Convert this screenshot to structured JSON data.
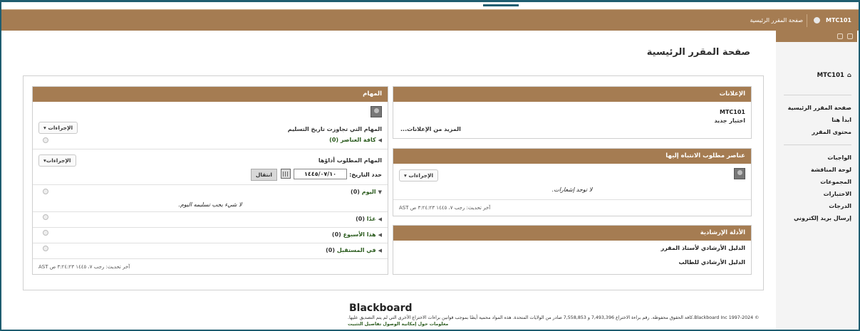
{
  "topbar": {
    "course_code": "MTC101",
    "home_link": "صفحة المقرر الرئيسية"
  },
  "sidebar": {
    "course_title": "MTC101",
    "home_icon": "house-icon",
    "group1": [
      "صفحة المقرر الرئيسية",
      "ابدأ هنا",
      "محتوى المقرر"
    ],
    "group2": [
      "الواجبات",
      "لوحة المناقشة",
      "المجموعات",
      "الاختبارات",
      "الدرجات",
      "إرسال بريد إلكتروني"
    ]
  },
  "main": {
    "title": "صفحة المقرر الرئيسية"
  },
  "announcements": {
    "title": "الإعلانات",
    "course": "MTC101",
    "item": "اختبار جديد",
    "more": "المزيد من الإعلانات..."
  },
  "needs_attention": {
    "title": "عناصر مطلوب الانتباه إليها",
    "actions": "الإجراءات",
    "empty": "لا توجد إشعارات.",
    "updated": "آخر تحديث: رجب ٧، ١٤٤٥ ٣:٢٤:٢٣ ص AST"
  },
  "guides": {
    "title": "الأدلة الإرشادية",
    "items": [
      "الدليل الأرشادي لأستاذ المقرر",
      "الدليل الأرشادي للطالب"
    ]
  },
  "tasks": {
    "title": "المهام",
    "overdue_label": "المهام التي تجاوزت تاريخ التسليم",
    "actions1": "الإجراءات",
    "all_items": "كافة العناصر (0)",
    "due_label": "المهام المطلوب أداؤها",
    "actions2": "الإجراءات",
    "date_label": "حدد التاريخ:",
    "date_value": "١٤٤٥/٠٧/١٠",
    "go": "انتقال",
    "today_label": "اليوم",
    "today_count": "(0)",
    "today_empty": "لا شيء يجب تسليمه اليوم.",
    "tomorrow": "غدًا",
    "tomorrow_count": "(0)",
    "week": "هذا الأسبوع",
    "week_count": "(0)",
    "future": "في المستقبل",
    "future_count": "(0)",
    "updated": "آخر تحديث: رجب ٧، ١٤٤٥ ٣:٢٤:٢٣ ص AST"
  },
  "footer": {
    "logo": "Blackboard",
    "copyright": "© 1997-2024 Blackboard Inc.كافة الحقوق محفوظة. رقم براءة الاختراع 7,493,396 و 7,558,853 صادر من الولايات المتحدة. هذه المواد محمية أيضًا بموجب قوانين براءات الاختراع الأخرى التي لم يتم التصديق عليها.",
    "links": "معلومات حول إمكانية الوصول  تفاصيل التثبيت"
  },
  "colors": {
    "header": "#a57c52",
    "accent": "#1f5d70"
  }
}
